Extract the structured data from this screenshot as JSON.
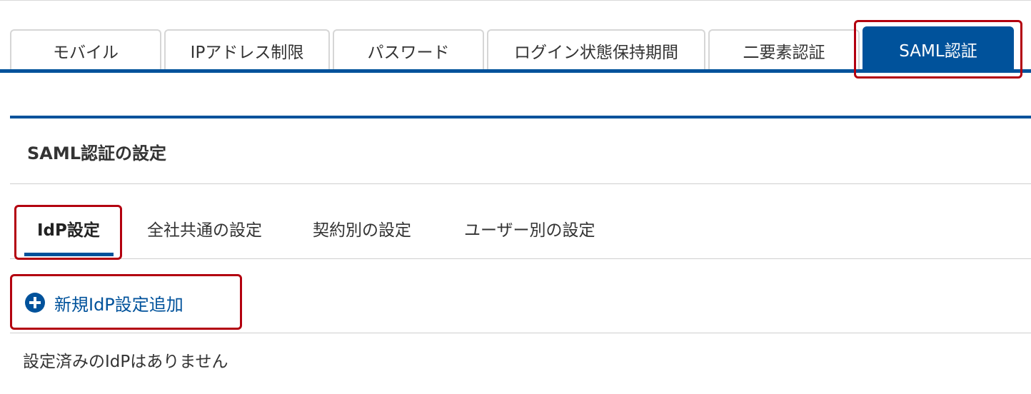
{
  "top_tabs": [
    {
      "label": "モバイル",
      "active": false
    },
    {
      "label": "IPアドレス制限",
      "active": false
    },
    {
      "label": "パスワード",
      "active": false
    },
    {
      "label": "ログイン状態保持期間",
      "active": false
    },
    {
      "label": "二要素認証",
      "active": false
    },
    {
      "label": "SAML認証",
      "active": true
    }
  ],
  "section": {
    "title": "SAML認証の設定"
  },
  "sub_tabs": [
    {
      "label": "IdP設定",
      "active": true
    },
    {
      "label": "全社共通の設定",
      "active": false
    },
    {
      "label": "契約別の設定",
      "active": false
    },
    {
      "label": "ユーザー別の設定",
      "active": false
    }
  ],
  "actions": {
    "add_idp_label": "新規IdP設定追加",
    "add_icon": "plus-circle-icon"
  },
  "idp_list": {
    "empty_message": "設定済みのIdPはありません"
  },
  "colors": {
    "brand": "#00529b",
    "highlight": "#b3000f",
    "tab_border": "#d6d6d6"
  }
}
